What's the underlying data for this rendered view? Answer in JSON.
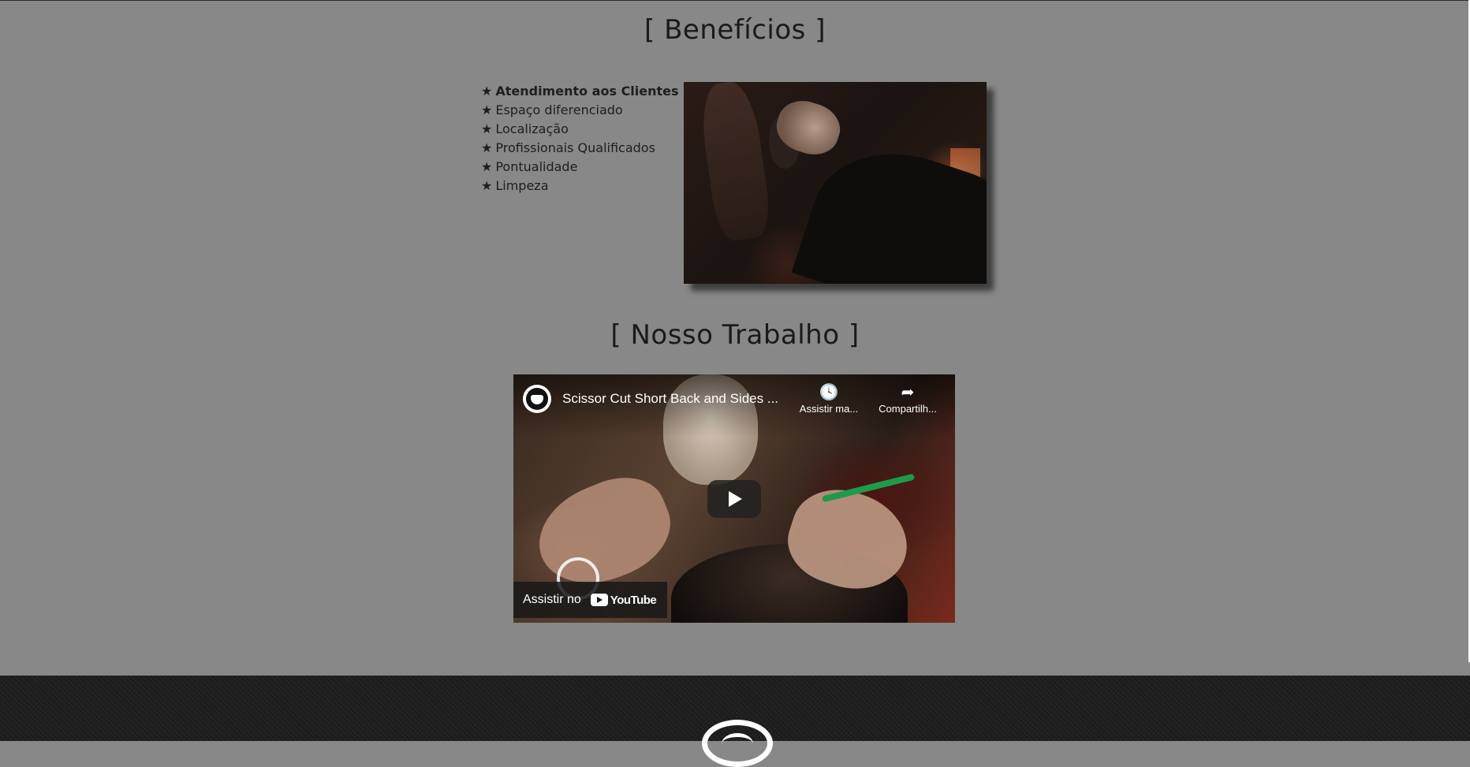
{
  "sections": {
    "benefits_title": "[ Benefícios ]",
    "work_title": "[ Nosso Trabalho ]"
  },
  "benefits": {
    "star": "★",
    "items": [
      "Atendimento aos Clientes",
      "Espaço diferenciado",
      "Localização",
      "Profissionais Qualificados",
      "Pontualidade",
      "Limpeza"
    ]
  },
  "video": {
    "title": "Scissor Cut Short Back and Sides ...",
    "watch_later_label": "Assistir ma...",
    "share_label": "Compartilh...",
    "watch_on_label": "Assistir no",
    "platform_label": "YouTube",
    "watch_later_icon": "clock-icon",
    "share_icon": "share-arrow-icon"
  },
  "colors": {
    "page_background": "#888888",
    "footer_background": "#1f1f1f",
    "text": "#1a1a1a"
  }
}
